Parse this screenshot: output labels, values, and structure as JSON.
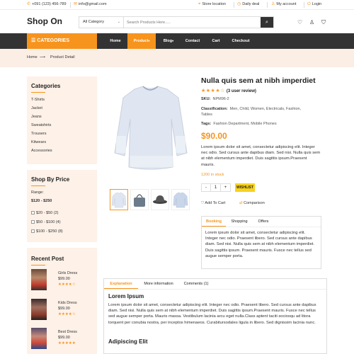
{
  "topbar": {
    "phone": "+091 (123) 456-789",
    "email": "info@gmail.com",
    "store_location": "Store location",
    "daily_deal": "Daily deal",
    "my_account": "My account",
    "login": "Login"
  },
  "header": {
    "logo": "Shop On",
    "search_category": "All Category",
    "search_placeholder": "Search Products Here....."
  },
  "nav": {
    "categories_label": "CATEGORIES",
    "items": [
      "Home",
      "Product",
      "Blog",
      "Contact",
      "Cart",
      "Checkout"
    ]
  },
  "breadcrumb": {
    "home": "Home",
    "current": "Product Detail"
  },
  "sidebar": {
    "categories_title": "Categories",
    "categories": [
      "T-Shirts",
      "Jacket",
      "Jeans",
      "Sweatshirts",
      "Trousers",
      "Kitwears",
      "Accessories"
    ],
    "price_title": "Shop By Price",
    "range_label": "Range:",
    "range_value": "$120 - $250",
    "price_options": [
      "$20 - $50 (2)",
      "$50 - $100 (4)",
      "$100 - $250 (8)"
    ],
    "recent_title": "Recent Post",
    "recent_posts": [
      {
        "name": "Girls Dress",
        "price": "$99.00",
        "stars": "★★★★☆"
      },
      {
        "name": "Kids Dress",
        "price": "$99.00",
        "stars": "★★★★☆"
      },
      {
        "name": "Best Dress",
        "price": "$99.00",
        "stars": "★★★★★"
      }
    ]
  },
  "product": {
    "title": "Nulla quis sem at nibh imperdiet",
    "stars": "★★★★☆",
    "reviews": "(3 user review)",
    "sku_label": "SKU:",
    "sku_value": "NPM96-2",
    "classification_label": "Classification:",
    "classification_value": "Men, Child, Women, Electricals, Fashion,",
    "classification_value2": "Tables",
    "tags_label": "Tags:",
    "tags_value": "Fashion Department, Mobile Phones",
    "price": "$90.00",
    "description": "Nulla quis sem at nibh elementum imperdiet. Duis sagittis ipsum. Praesent mauris. Fusce nec tellus sed augue semper porta.",
    "description_full": "Lorem ipsum dolor sit amet, consectetur adipiscing elit. Integer nec odio. Sed cursus ante dapibus diam. Sed nisi. Nulla quis sem at nibh elementum imperdiet. Duis sagittis ipsum.Praesent mauris.",
    "stock": "1200 in stock",
    "qty_minus": "-",
    "qty_value": "1",
    "qty_plus": "+",
    "wishlist": "WISHLIST",
    "add_to_cart": "Add To Cart",
    "comparison": "Comparison"
  },
  "tabs": {
    "items": [
      "Booking",
      "Shopping",
      "Offers"
    ],
    "content": "Lorem ipsum dolor sit amet, consectetur adipiscing elit. Integer nec odio. Praesent libero. Sed cursus ante dapibus diam. Sed nisi. Nulla quis sem at nibh elementum imperdiet. Duis sagittis ipsum. Praesent mauris. Fusce nec tellus sed augue semper porta."
  },
  "lower_tabs": {
    "items": [
      "Explanation",
      "More information",
      "Comments (1)"
    ],
    "heading1": "Lorem Ipsum",
    "text1": "Lorem ipsum dolor sit amet, consectetur adipiscing elit. Integer nec odio. Praesent libero. Sed cursus ante dapibus diam. Sed nisi. Nulla quis sem at nibh elementum imperdiet. Duis sagittis ipsum.Praesent mauris. Fusce nec tellus sed augue semper porta. Mauris massa. Vestibulum lacinia arcu eget nulla.Class aptent taciti sociosqu ad litora torquent per conubia nostra, per inceptos himenaeos. Curabitursodales ligula in libero. Sed dignissim lacinia nunc.",
    "heading2": "Adipiscing Elit"
  },
  "colors": {
    "accent": "#f7941d",
    "nav_bg": "#333333",
    "panel_bg": "#fdf1e8"
  }
}
